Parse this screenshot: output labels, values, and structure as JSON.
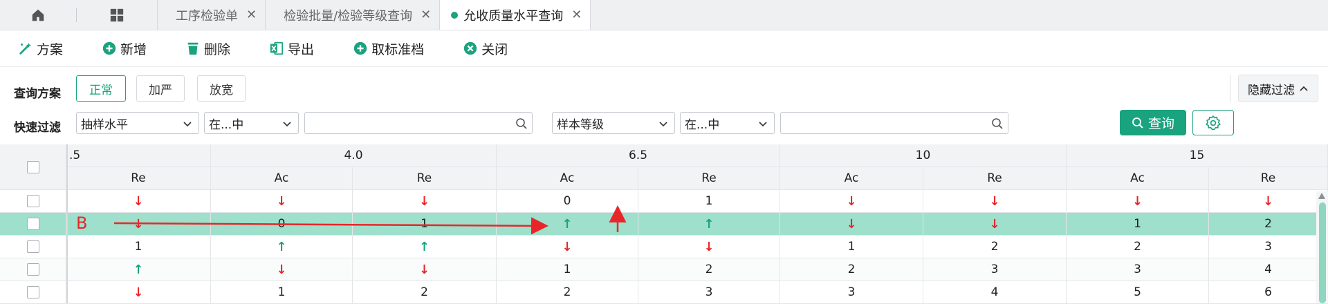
{
  "tabs": {
    "home_icon": "home-icon",
    "grid_icon": "grid-icon",
    "items": [
      {
        "label": "工序检验单",
        "active": false
      },
      {
        "label": "检验批量/检验等级查询",
        "active": false
      },
      {
        "label": "允收质量水平查询",
        "active": true
      }
    ],
    "close_glyph": "✕"
  },
  "toolbar": {
    "scheme": "方案",
    "add": "新增",
    "delete": "删除",
    "export": "导出",
    "cancel_archive": "取标准档",
    "close": "关闭"
  },
  "query": {
    "scheme_label": "查询方案",
    "modes": [
      "正常",
      "加严",
      "放宽"
    ],
    "hide_filter": "隐藏过滤",
    "quick_filter_label": "快速过滤",
    "filter1_field": "抽样水平",
    "filter1_op": "在...中",
    "filter2_field": "样本等级",
    "filter2_op": "在...中",
    "query_button": "查询"
  },
  "grid": {
    "group_headers": [
      ".5",
      "4.0",
      "6.5",
      "10",
      "15"
    ],
    "sub_headers": [
      "Re",
      "Ac",
      "Re",
      "Ac",
      "Re",
      "Ac",
      "Re",
      "Ac",
      "Re"
    ],
    "rows": [
      {
        "cells": [
          "↓",
          "↓",
          "↓",
          "0",
          "1",
          "↓",
          "↓",
          "↓",
          "↓"
        ],
        "highlight": false
      },
      {
        "cells": [
          "↓",
          "0",
          "1",
          "↑",
          "↑",
          "↓",
          "↓",
          "1",
          "2"
        ],
        "highlight": true
      },
      {
        "cells": [
          "1",
          "↑",
          "↑",
          "↓",
          "↓",
          "1",
          "2",
          "2",
          "3"
        ],
        "highlight": false
      },
      {
        "cells": [
          "↑",
          "↓",
          "↓",
          "1",
          "2",
          "2",
          "3",
          "3",
          "4"
        ],
        "highlight": false
      },
      {
        "cells": [
          "↓",
          "1",
          "2",
          "2",
          "3",
          "3",
          "4",
          "5",
          "6"
        ],
        "highlight": false
      }
    ]
  },
  "annotation": {
    "label": "B",
    "color": "#e8262a"
  },
  "colors": {
    "accent": "#19a37e",
    "highlight_row": "#9ee0cb",
    "down_arrow": "#e8262a",
    "up_arrow": "#19a37e"
  }
}
